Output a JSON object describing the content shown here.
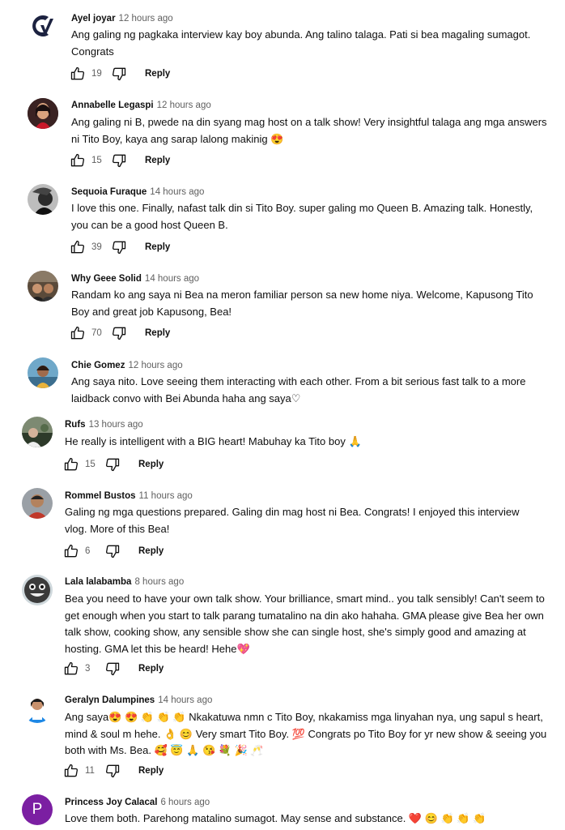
{
  "comments": [
    {
      "author": "Ayel joyar",
      "time": "12 hours ago",
      "text": "Ang galing ng pagkaka interview kay boy abunda. Ang talino talaga. Pati si bea magaling sumagot. Congrats",
      "likes": "19",
      "reply": "Reply",
      "avatar": "gv-logo"
    },
    {
      "author": "Annabelle Legaspi",
      "time": "12 hours ago",
      "text": "Ang galing ni B, pwede na din syang mag host on a talk show! Very insightful talaga ang mga answers ni Tito Boy, kaya ang sarap lalong makinig 😍",
      "likes": "15",
      "reply": "Reply",
      "avatar": "photo"
    },
    {
      "author": "Sequoia Furaque",
      "time": "14 hours ago",
      "text": "I love this one. Finally, nafast talk din si Tito Boy. super galing mo Queen B. Amazing talk. Honestly, you can be a good host Queen B.",
      "likes": "39",
      "reply": "Reply",
      "avatar": "photo"
    },
    {
      "author": "Why Geee Solid",
      "time": "14 hours ago",
      "text": "Randam ko ang saya ni Bea na meron familiar person sa new home niya. Welcome, Kapusong Tito Boy and great job Kapusong, Bea!",
      "likes": "70",
      "reply": "Reply",
      "avatar": "photo"
    },
    {
      "author": "Chie Gomez",
      "time": "12 hours ago",
      "text": "Ang saya nito. Love seeing them interacting with each other. From a bit serious fast talk to a more laidback convo with Bei Abunda haha ang saya♡",
      "likes": "",
      "reply": "",
      "avatar": "photo"
    },
    {
      "author": "Rufs",
      "time": "13 hours ago",
      "text": "He really is intelligent with a BIG heart! Mabuhay ka Tito boy 🙏",
      "likes": "15",
      "reply": "Reply",
      "avatar": "photo"
    },
    {
      "author": "Rommel Bustos",
      "time": "11 hours ago",
      "text": "Galing ng mga questions prepared. Galing din mag host ni Bea. Congrats! I enjoyed this interview vlog. More of this Bea!",
      "likes": "6",
      "reply": "Reply",
      "avatar": "photo"
    },
    {
      "author": "Lala lalabamba",
      "time": "8 hours ago",
      "text": "Bea you need to have your own talk show. Your brilliance, smart mind.. you talk sensibly! Can't seem to get enough when you start to talk parang tumatalino na din ako hahaha. GMA please give Bea her own talk show, cooking show, any sensible show she can single host, she's simply good and amazing at hosting. GMA let this be heard! Hehe💖",
      "likes": "3",
      "reply": "Reply",
      "avatar": "photo"
    },
    {
      "author": "Geralyn Dalumpines",
      "time": "14 hours ago",
      "text": "Ang saya😍 😍 👏 👏 👏 Nkakatuwa nmn c Tito Boy, nkakamiss mga linyahan nya, ung sapul s heart, mind &  soul m hehe. 👌 😊  Very smart Tito Boy. 💯  Congrats po Tito Boy for yr new show &  seeing you both with Ms. Bea. 🥰 😇 🙏 😘 💐 🎉 🥂",
      "likes": "11",
      "reply": "Reply",
      "avatar": "photo"
    },
    {
      "author": "Princess Joy Calacal",
      "time": "6 hours ago",
      "text": "Love them both. Parehong matalino sumagot. May sense and substance. ❤️ 😊 👏 👏 👏",
      "likes": "",
      "reply": "",
      "avatar": "P"
    }
  ],
  "colors": {
    "text": "#0f0f0f",
    "secondary": "#606060",
    "avatar_p": "#7b1fa2"
  },
  "icons": {
    "like": "thumb-up-icon",
    "dislike": "thumb-down-icon"
  }
}
